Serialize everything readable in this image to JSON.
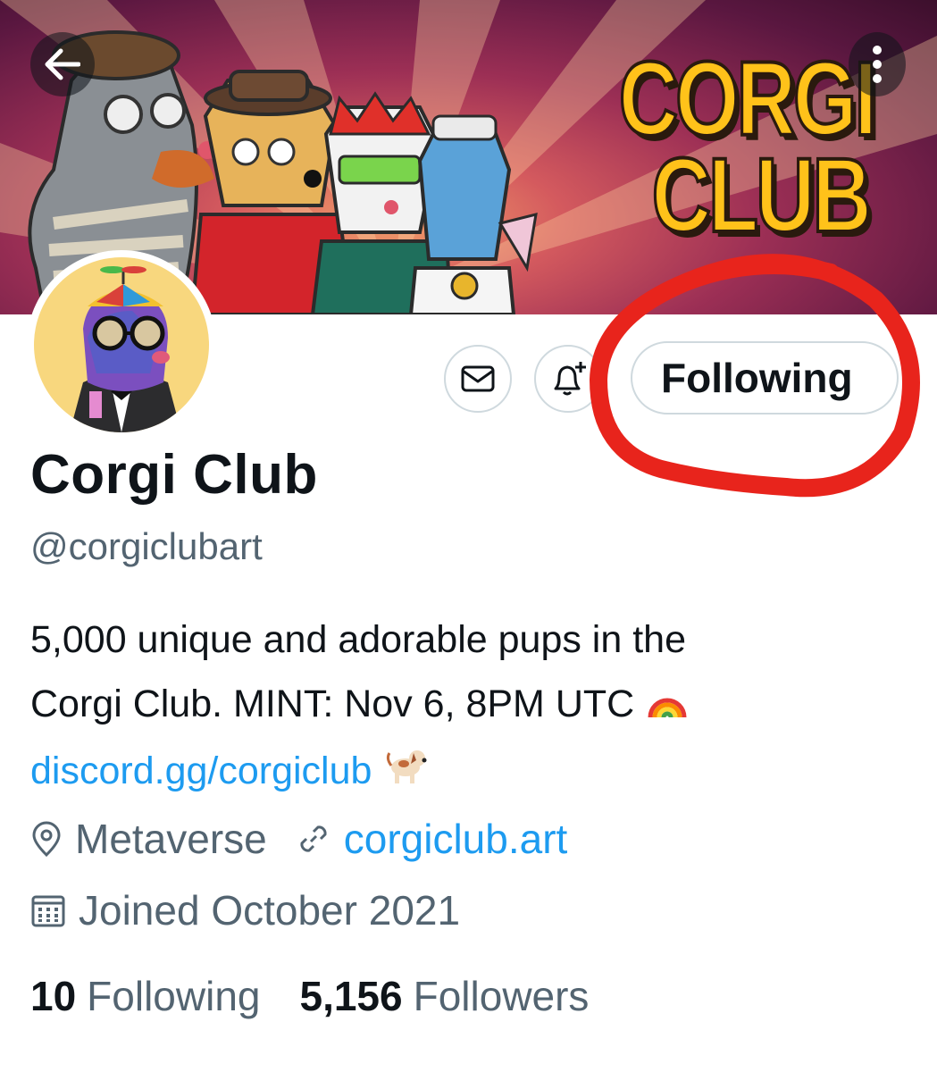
{
  "banner": {
    "logo_line1": "CORGI",
    "logo_line2": "CLUB",
    "back_icon": "arrow-left-icon",
    "more_icon": "more-vertical-icon"
  },
  "profile": {
    "name": "Corgi Club",
    "handle": "@corgiclubart",
    "bio_line1": "5,000 unique and adorable pups in the",
    "bio_line2": "Corgi Club. MINT: Nov 6, 8PM UTC",
    "bio_link": "discord.gg/corgiclub",
    "location": "Metaverse",
    "website": "corgiclub.art",
    "joined": "Joined October 2021"
  },
  "actions": {
    "message_icon": "mail-icon",
    "notify_icon": "bell-plus-icon",
    "follow_label": "Following"
  },
  "stats": {
    "following_count": "10",
    "following_label": "Following",
    "followers_count": "5,156",
    "followers_label": "Followers"
  },
  "colors": {
    "link": "#1d9bf0",
    "secondary_text": "#536471",
    "annotation_red": "#e8241c",
    "logo_yellow": "#ffc21a"
  }
}
